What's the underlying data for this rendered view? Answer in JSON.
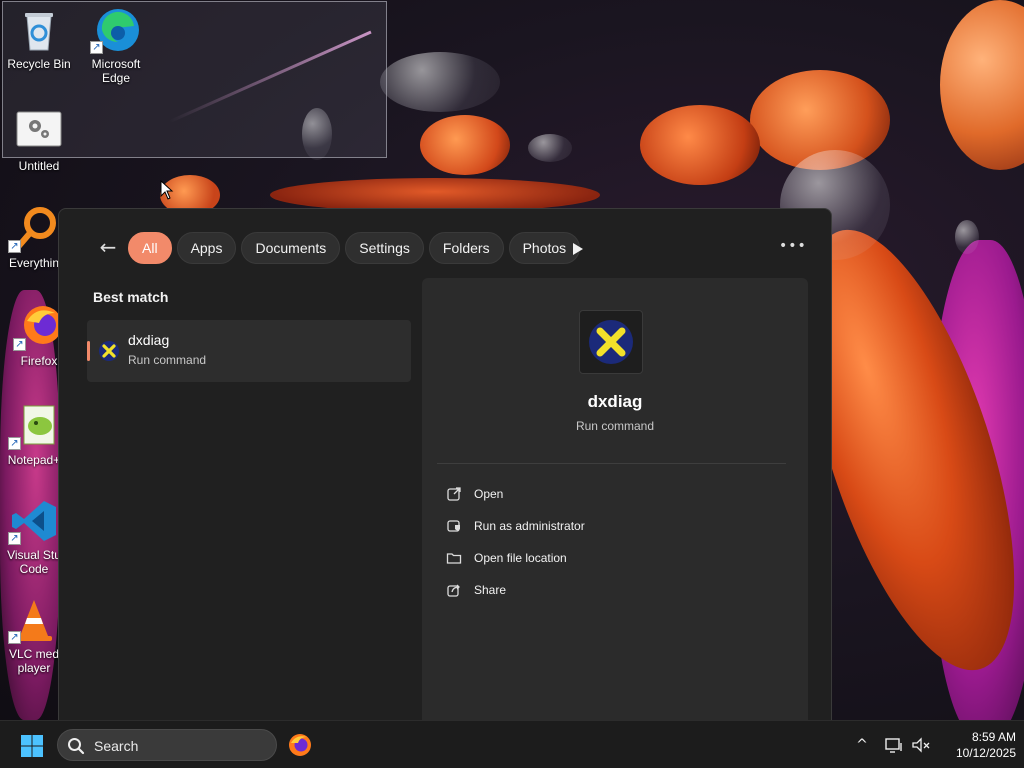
{
  "desktop": {
    "icons": [
      {
        "label": "Recycle Bin",
        "icon": "recycle-bin-icon"
      },
      {
        "label": "Microsoft Edge",
        "icon": "edge-icon"
      },
      {
        "label": "Untitled",
        "icon": "settings-file-icon"
      },
      {
        "label": "Everythin",
        "icon": "everything-search-icon"
      },
      {
        "label": "Firefox",
        "icon": "firefox-icon"
      },
      {
        "label": "Notepad+",
        "icon": "notepad-plus-plus-icon"
      },
      {
        "label": "Visual Stu Code",
        "icon": "vscode-icon"
      },
      {
        "label": "VLC med player",
        "icon": "vlc-icon"
      }
    ]
  },
  "search_panel": {
    "filters": [
      {
        "label": "All",
        "active": true
      },
      {
        "label": "Apps"
      },
      {
        "label": "Documents"
      },
      {
        "label": "Settings"
      },
      {
        "label": "Folders"
      },
      {
        "label": "Photos"
      }
    ],
    "best_match_heading": "Best match",
    "result": {
      "name": "dxdiag",
      "type": "Run command"
    },
    "detail": {
      "name": "dxdiag",
      "type": "Run command",
      "actions": [
        {
          "label": "Open",
          "icon": "open-external-icon"
        },
        {
          "label": "Run as administrator",
          "icon": "shield-admin-icon"
        },
        {
          "label": "Open file location",
          "icon": "folder-icon"
        },
        {
          "label": "Share",
          "icon": "share-icon"
        }
      ]
    },
    "accent_color": "#f28a6a"
  },
  "taskbar": {
    "search_placeholder": "Search",
    "time": "8:59 AM",
    "date": "10/12/2025"
  }
}
